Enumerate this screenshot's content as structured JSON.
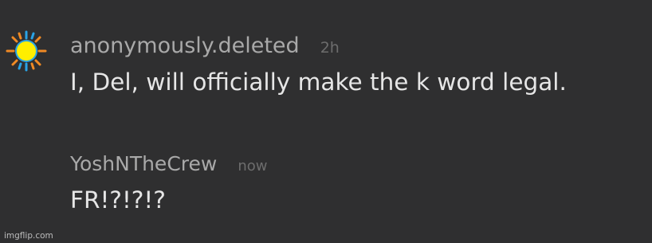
{
  "comments": [
    {
      "username": "anonymously.deleted",
      "time": "2h",
      "avatar_icon": "sun-icon",
      "text": "I, Del, will officially make the k word legal."
    },
    {
      "username": "YoshNTheCrew",
      "time": "now",
      "text": "FR!?!?!?"
    }
  ],
  "watermark": "imgflip.com",
  "colors": {
    "background": "#2f2f30",
    "username": "#a9a9a9",
    "timestamp": "#6d6d6d",
    "comment_text": "#e6e6e6",
    "sun_core": "#ffee00",
    "sun_rays_orange": "#f08a24",
    "sun_rays_blue": "#29a3e6"
  }
}
